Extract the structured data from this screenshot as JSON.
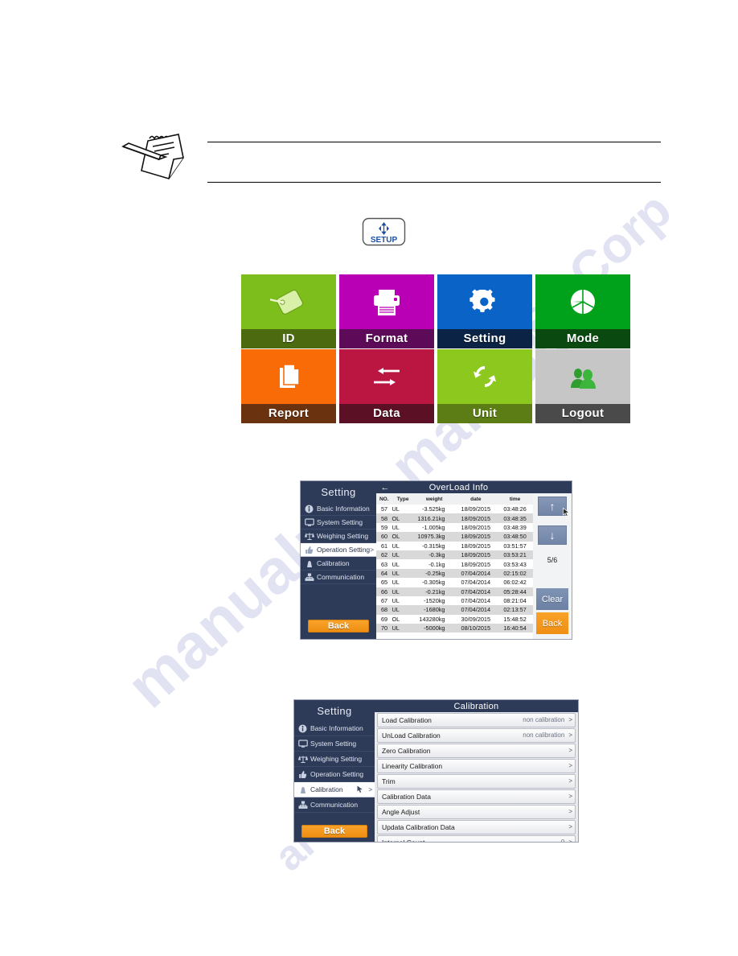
{
  "document": {
    "note_icon": "notepad-pencil-icon",
    "setup_key": {
      "label": "SETUP",
      "icon": "vertical-arrows-icon"
    },
    "watermark": [
      "manualzz",
      "manuals",
      "archive",
      "ee Corp"
    ]
  },
  "tiles": [
    {
      "label": "ID",
      "icon": "tag-icon",
      "body": "#7dbe1c",
      "bar": "#4c6b10"
    },
    {
      "label": "Format",
      "icon": "printer-icon",
      "body": "#ba00b5",
      "bar": "#5d0a58"
    },
    {
      "label": "Setting",
      "icon": "gear-icon",
      "body": "#0a64c8",
      "bar": "#0b2344"
    },
    {
      "label": "Mode",
      "icon": "pie-chart-icon",
      "body": "#00a21b",
      "bar": "#0a4a11"
    },
    {
      "label": "Report",
      "icon": "documents-icon",
      "body": "#f96b07",
      "bar": "#6b3210"
    },
    {
      "label": "Data",
      "icon": "transfer-arrows-icon",
      "body": "#bb1541",
      "bar": "#5c1025"
    },
    {
      "label": "Unit",
      "icon": "refresh-icon",
      "body": "#8dc81e",
      "bar": "#5c7c15"
    },
    {
      "label": "Logout",
      "icon": "users-icon",
      "body": "#c6c6c6",
      "bar": "#4a4a4a"
    }
  ],
  "overload_screen": {
    "sidebar": {
      "title": "Setting",
      "items": [
        {
          "label": "Basic Information",
          "icon": "info-icon",
          "arrow": "",
          "active": false
        },
        {
          "label": "System Setting",
          "icon": "monitor-icon",
          "arrow": "",
          "active": false
        },
        {
          "label": "Weighing Setting",
          "icon": "balance-icon",
          "arrow": "",
          "active": false
        },
        {
          "label": "Operation Setting",
          "icon": "thumb-icon",
          "arrow": ">",
          "active": true
        },
        {
          "label": "Calibration",
          "icon": "weight-icon",
          "arrow": "",
          "active": false
        },
        {
          "label": "Communication",
          "icon": "network-icon",
          "arrow": "",
          "active": false
        }
      ],
      "back_label": "Back"
    },
    "header": {
      "title": "OverLoad Info",
      "back_arrow": "←"
    },
    "columns": [
      "NO.",
      "Type",
      "weight",
      "date",
      "time"
    ],
    "rows": [
      [
        "57",
        "UL",
        "-3.525kg",
        "18/09/2015",
        "03:48:26"
      ],
      [
        "58",
        "OL",
        "1316.21kg",
        "18/09/2015",
        "03:48:35"
      ],
      [
        "59",
        "UL",
        "-1.005kg",
        "18/09/2015",
        "03:48:39"
      ],
      [
        "60",
        "OL",
        "10975.3kg",
        "18/09/2015",
        "03:48:50"
      ],
      [
        "61",
        "UL",
        "-0.315kg",
        "18/09/2015",
        "03:51:57"
      ],
      [
        "62",
        "UL",
        "-0.3kg",
        "18/09/2015",
        "03:53:21"
      ],
      [
        "63",
        "UL",
        "-0.1kg",
        "18/09/2015",
        "03:53:43"
      ],
      [
        "64",
        "UL",
        "-0.25kg",
        "07/04/2014",
        "02:15:02"
      ],
      [
        "65",
        "UL",
        "-0.305kg",
        "07/04/2014",
        "06:02:42"
      ],
      [
        "66",
        "UL",
        "-0.21kg",
        "07/04/2014",
        "05:28:44"
      ],
      [
        "67",
        "UL",
        "-1520kg",
        "07/04/2014",
        "08:21:04"
      ],
      [
        "68",
        "UL",
        "-1680kg",
        "07/04/2014",
        "02:13:57"
      ],
      [
        "69",
        "OL",
        "143280kg",
        "30/09/2015",
        "15:48:52"
      ],
      [
        "70",
        "UL",
        "-5000kg",
        "08/10/2015",
        "16:40:54"
      ]
    ],
    "controls": {
      "up": "↑",
      "down": "↓",
      "page_indicator": "5/6",
      "clear_label": "Clear",
      "back_label": "Back"
    }
  },
  "calibration_screen": {
    "sidebar": {
      "title": "Setting",
      "items": [
        {
          "label": "Basic Information",
          "icon": "info-icon",
          "arrow": "",
          "active": false
        },
        {
          "label": "System Setting",
          "icon": "monitor-icon",
          "arrow": "",
          "active": false
        },
        {
          "label": "Weighing Setting",
          "icon": "balance-icon",
          "arrow": "",
          "active": false
        },
        {
          "label": "Operation Setting",
          "icon": "thumb-icon",
          "arrow": "",
          "active": false
        },
        {
          "label": "Calibration",
          "icon": "weight-icon",
          "arrow": ">",
          "active": true
        },
        {
          "label": "Communication",
          "icon": "network-icon",
          "arrow": "",
          "active": false
        }
      ],
      "back_label": "Back"
    },
    "header": {
      "title": "Calibration"
    },
    "items": [
      {
        "label": "Load Calibration",
        "value": "non calibration",
        "chevron": ">"
      },
      {
        "label": "UnLoad Calibration",
        "value": "non calibration",
        "chevron": ">"
      },
      {
        "label": "Zero Calibration",
        "value": "",
        "chevron": ">"
      },
      {
        "label": "Linearity Calibration",
        "value": "",
        "chevron": ">"
      },
      {
        "label": "Trim",
        "value": "",
        "chevron": ">"
      },
      {
        "label": "Calibration Data",
        "value": "",
        "chevron": ">"
      },
      {
        "label": "Angle Adjust",
        "value": "",
        "chevron": ">"
      },
      {
        "label": "Updata Calibration Data",
        "value": "",
        "chevron": ">"
      },
      {
        "label": "Internal Count",
        "value": "0",
        "chevron": ">"
      }
    ]
  }
}
